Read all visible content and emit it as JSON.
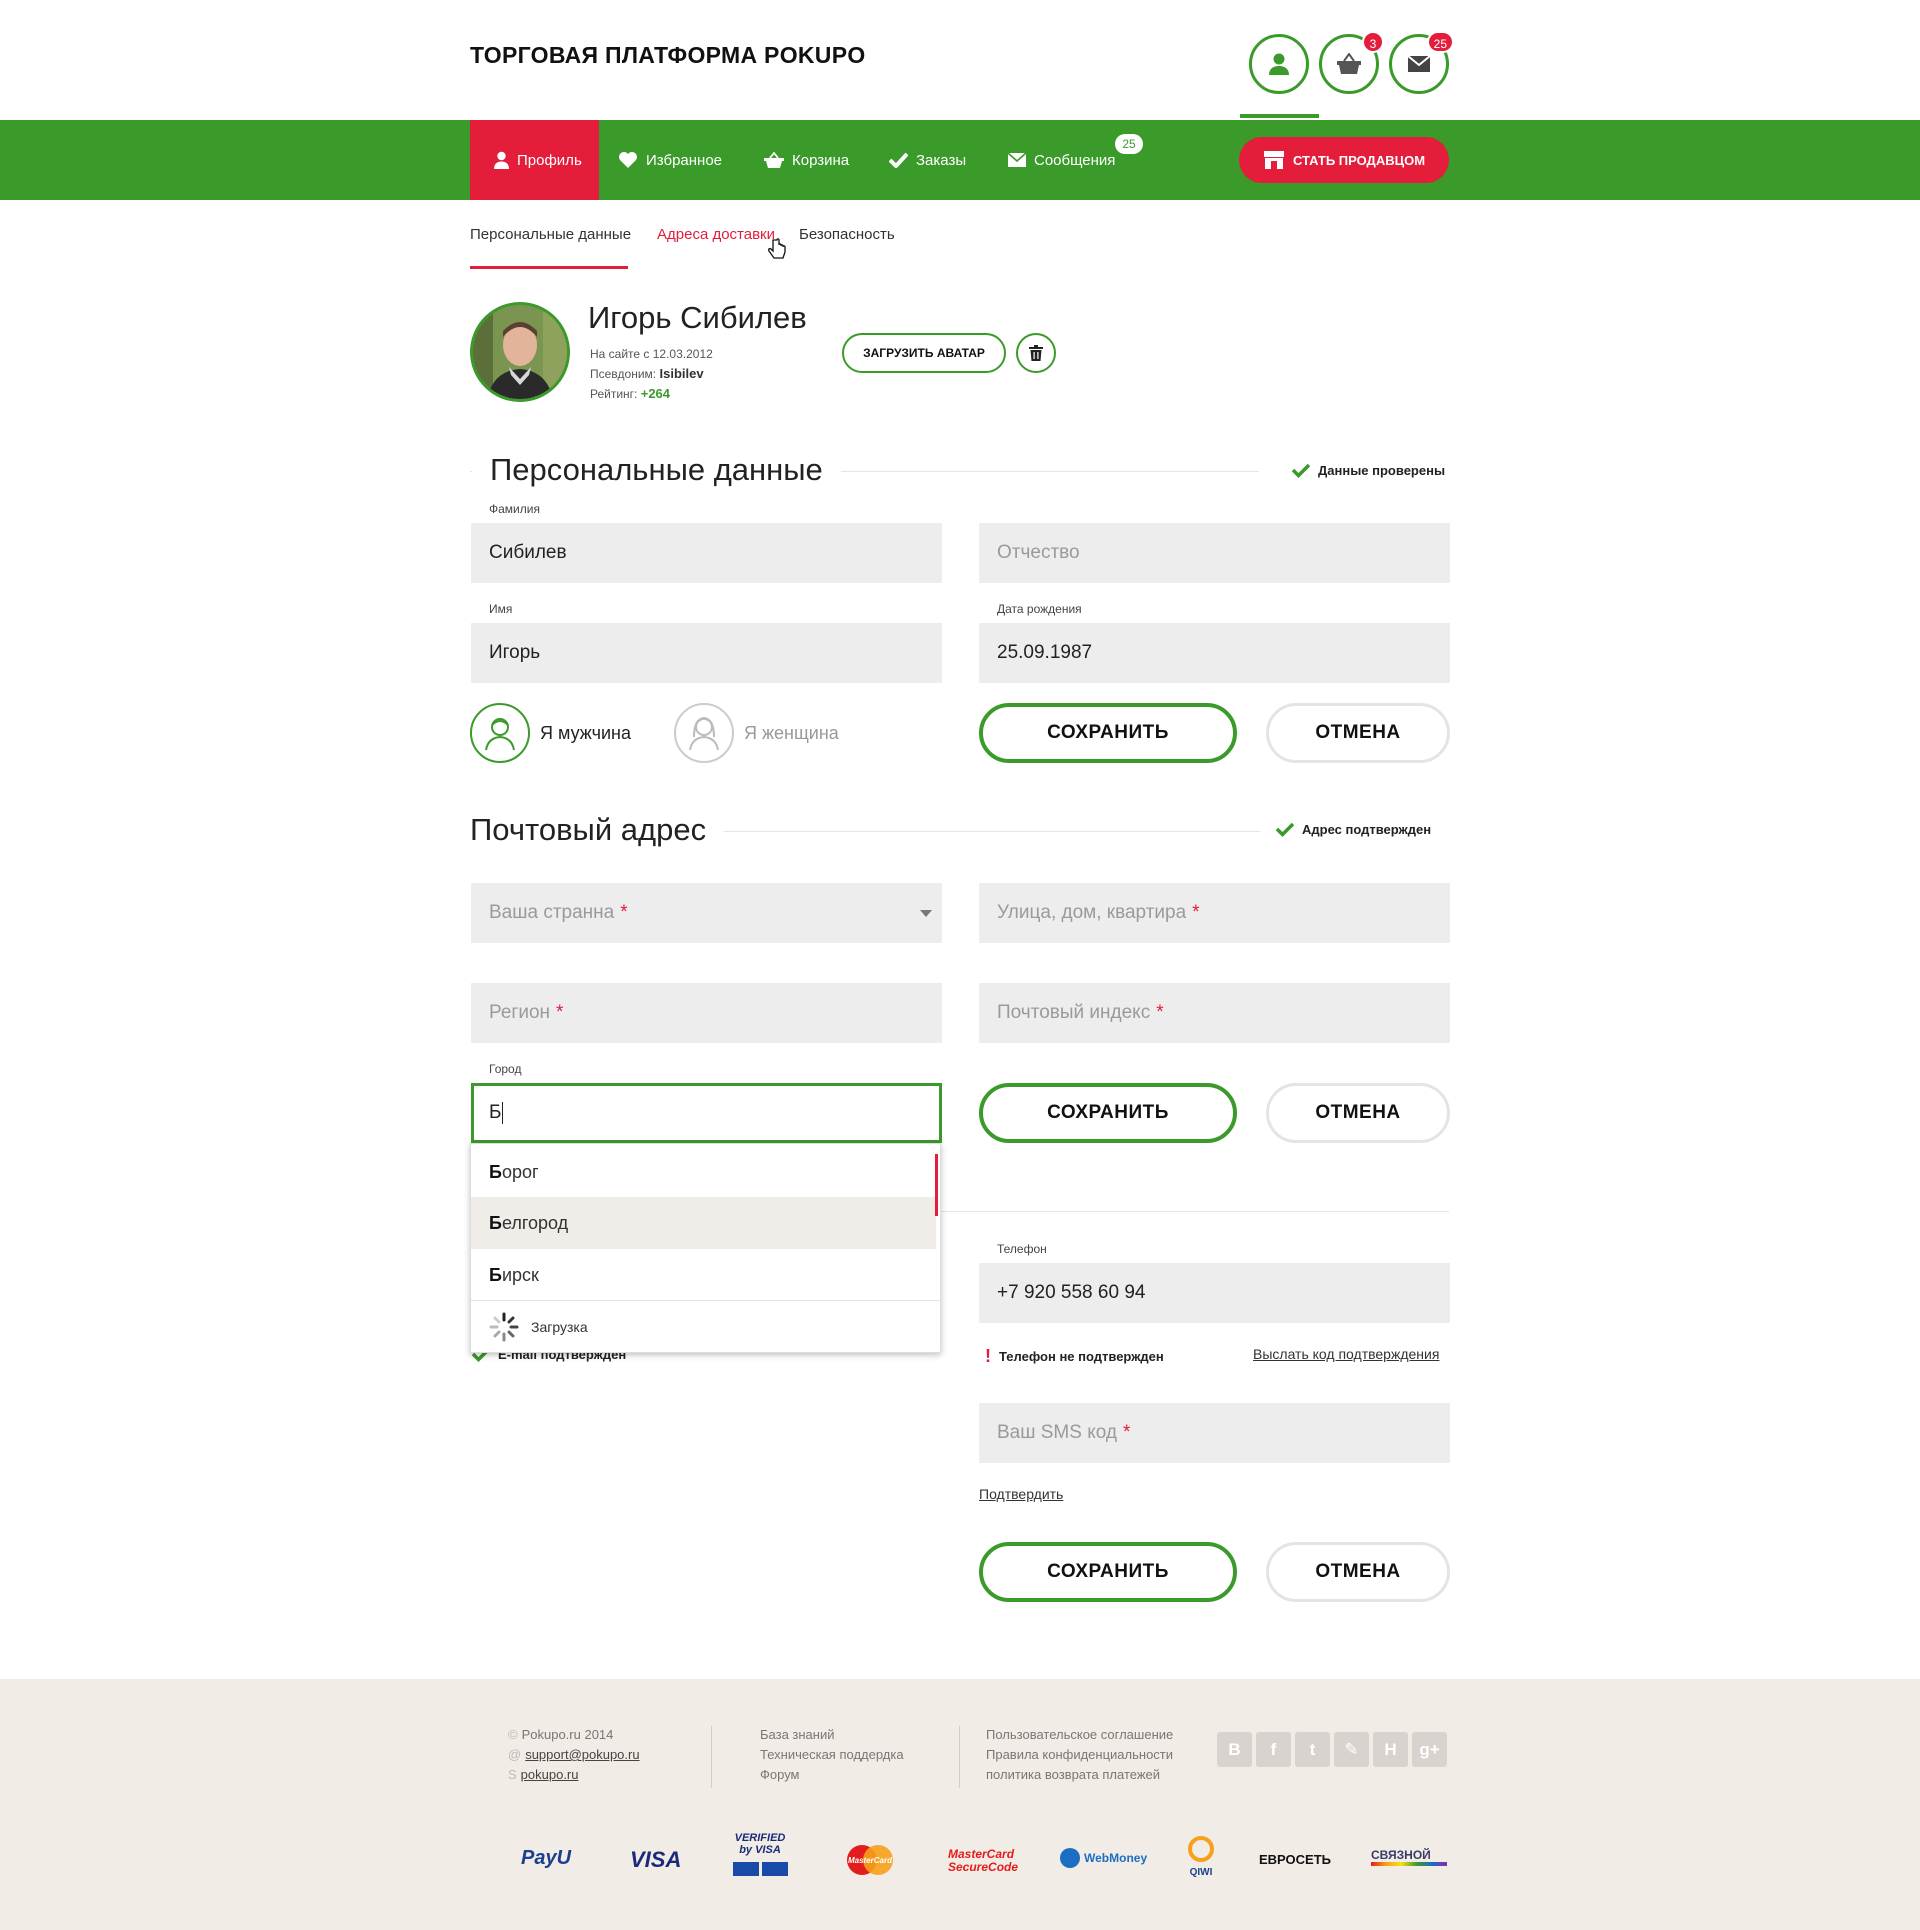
{
  "header": {
    "brand": "ТОРГОВАЯ ПЛАТФОРМА POKUPO",
    "cart_count": "3",
    "messages_count": "25"
  },
  "nav": {
    "items": [
      {
        "label": "Профиль",
        "icon": "user-icon"
      },
      {
        "label": "Избранное",
        "icon": "heart-icon"
      },
      {
        "label": "Корзина",
        "icon": "basket-icon"
      },
      {
        "label": "Заказы",
        "icon": "check-icon"
      },
      {
        "label": "Сообщения",
        "icon": "envelope-icon"
      }
    ],
    "messages_badge": "25",
    "seller_button": "СТАТЬ ПРОДАВЦОМ"
  },
  "subtabs": [
    "Персональные данные",
    "Адреса доставки",
    "Безопасность"
  ],
  "profile": {
    "name": "Игорь Сибилев",
    "since_label": "На сайте с 12.03.2012",
    "alias_label": "Псевдоним:",
    "alias": "Isibilev",
    "rating_label": "Рейтинг:",
    "rating": "+264",
    "upload_avatar": "ЗАГРУЗИТЬ АВАТАР"
  },
  "personal": {
    "title": "Персональные данные",
    "status": "Данные проверены",
    "lastname_label": "Фамилия",
    "lastname": "Сибилев",
    "patronymic_placeholder": "Отчество",
    "firstname_label": "Имя",
    "firstname": "Игорь",
    "birthdate_label": "Дата рождения",
    "birthdate": "25.09.1987",
    "male": "Я мужчина",
    "female": "Я женщина",
    "save": "СОХРАНИТЬ",
    "cancel": "ОТМЕНА"
  },
  "address": {
    "title": "Почтовый адрес",
    "status": "Адрес подтвержден",
    "country_placeholder": "Ваша странна",
    "street_placeholder": "Улица, дом, квартира",
    "region_placeholder": "Регион",
    "zip_placeholder": "Почтовый индекс",
    "city_label": "Город",
    "city_value": "Б",
    "save": "СОХРАНИТЬ",
    "cancel": "ОТМЕНА",
    "suggestions": [
      {
        "match": "Б",
        "rest": "орог"
      },
      {
        "match": "Б",
        "rest": "елгород"
      },
      {
        "match": "Б",
        "rest": "ирск"
      }
    ],
    "loading": "Загрузка"
  },
  "contacts": {
    "email_status": "E-mail подтвержден",
    "phone_label": "Телефон",
    "phone": "+7 920 558 60 94",
    "phone_status": "Телефон не подтвержден",
    "send_code": "Выслать код подтверждения",
    "sms_placeholder": "Ваш SMS код",
    "confirm": "Подтвердить",
    "save": "СОХРАНИТЬ",
    "cancel": "ОТМЕНА"
  },
  "footer": {
    "copyright": "Pokupo.ru 2014",
    "email": "support@pokupo.ru",
    "skype": "pokupo.ru",
    "links1": [
      "База знаний",
      "Техническая поддердка",
      "Форум"
    ],
    "links2": [
      "Пользовательское соглашение",
      "Правила конфиденциальности",
      "политика возврата платежей"
    ],
    "social": [
      "В",
      "f",
      "t",
      "✎",
      "H",
      "g+"
    ],
    "payments": [
      "PayU",
      "VISA",
      "VERIFIED by VISA",
      "MasterCard",
      "MasterCard SecureCode",
      "WebMoney",
      "QIWI",
      "ЕВРОСЕТЬ",
      "СВЯЗНОЙ"
    ]
  },
  "colors": {
    "green": "#3a9a2a",
    "red": "#e31d3a",
    "field": "#ededed",
    "footer": "#f1ece6"
  }
}
